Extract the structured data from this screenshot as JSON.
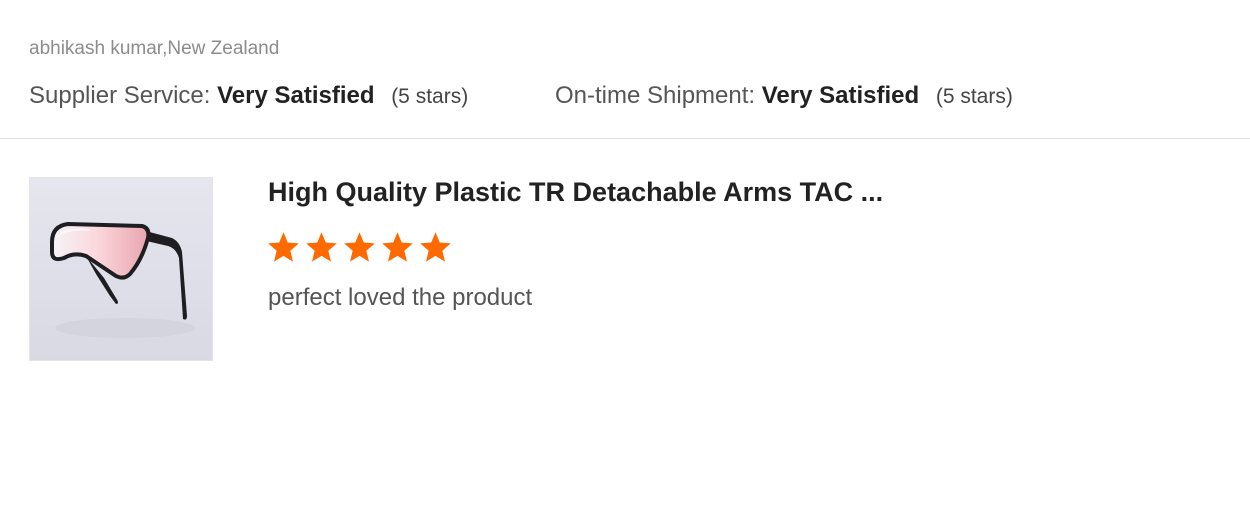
{
  "reviewer": {
    "name_location": "abhikash kumar,New Zealand"
  },
  "ratings": {
    "supplier_service": {
      "label": "Supplier Service:",
      "value": "Very Satisfied",
      "stars_text": "(5 stars)"
    },
    "on_time_shipment": {
      "label": "On-time Shipment:",
      "value": "Very Satisfied",
      "stars_text": "(5 stars)"
    }
  },
  "product": {
    "title": "High Quality Plastic TR Detachable Arms TAC ...",
    "image_icon": "sunglasses-image",
    "rating": 5,
    "rating_max": 5,
    "comment": "perfect loved the product"
  },
  "colors": {
    "star": "#ff6a00",
    "muted_text": "#8c8c8c",
    "divider": "#e2e2e2"
  }
}
